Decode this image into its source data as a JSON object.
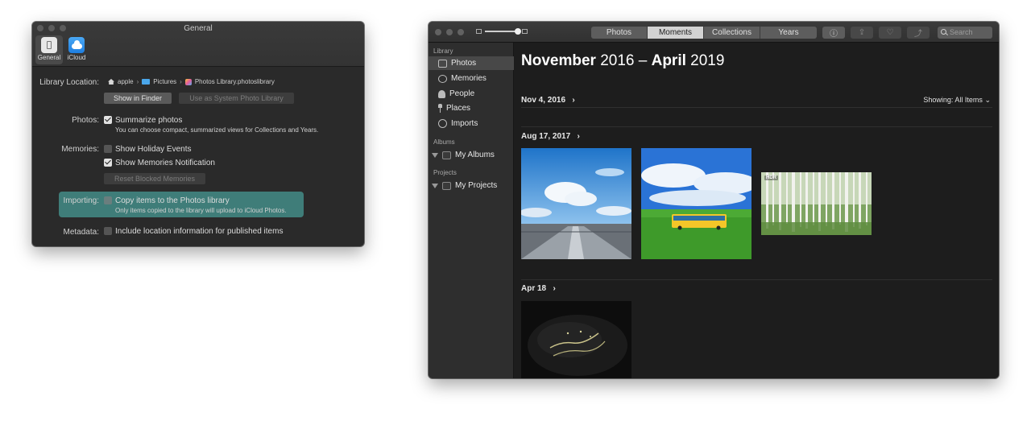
{
  "prefs": {
    "title": "General",
    "tabs": [
      {
        "label": "General",
        "icon": "general-icon"
      },
      {
        "label": "iCloud",
        "icon": "icloud-icon"
      }
    ],
    "library_location_label": "Library Location:",
    "path": [
      "apple",
      "Pictures",
      "Photos Library.photoslibrary"
    ],
    "show_in_finder": "Show in Finder",
    "use_as_system": "Use as System Photo Library",
    "photos_label": "Photos:",
    "summarize": {
      "label": "Summarize photos",
      "checked": true,
      "note": "You can choose compact, summarized views for Collections and Years."
    },
    "memories_label": "Memories:",
    "holiday": {
      "label": "Show Holiday Events",
      "checked": false
    },
    "memories_notif": {
      "label": "Show Memories Notification",
      "checked": true
    },
    "reset_blocked": "Reset Blocked Memories",
    "importing_label": "Importing:",
    "copy_items": {
      "label": "Copy items to the Photos library",
      "checked": false,
      "note": "Only items copied to the library will upload to iCloud Photos."
    },
    "metadata_label": "Metadata:",
    "location_info": {
      "label": "Include location information for published items",
      "checked": false
    },
    "highlight_color": "#3f7d79"
  },
  "photos": {
    "view_tabs": [
      "Photos",
      "Moments",
      "Collections",
      "Years"
    ],
    "active_tab": "Moments",
    "search_placeholder": "Search",
    "sidebar": {
      "library_header": "Library",
      "library_items": [
        {
          "label": "Photos",
          "icon": "photos-icon",
          "selected": true
        },
        {
          "label": "Memories",
          "icon": "memories-icon"
        },
        {
          "label": "People",
          "icon": "people-icon"
        },
        {
          "label": "Places",
          "icon": "places-icon"
        },
        {
          "label": "Imports",
          "icon": "imports-icon"
        }
      ],
      "albums_header": "Albums",
      "albums_item": "My Albums",
      "projects_header": "Projects",
      "projects_item": "My Projects"
    },
    "title_bold_1": "November",
    "title_light_1": " 2016 – ",
    "title_bold_2": "April",
    "title_light_2": " 2019",
    "sections": [
      {
        "date": "Nov 4, 2016"
      },
      {
        "date": "Aug 17, 2017"
      },
      {
        "date": "Apr 18"
      }
    ],
    "showing": "Showing: All Items",
    "hdr_badge": "HDR"
  }
}
